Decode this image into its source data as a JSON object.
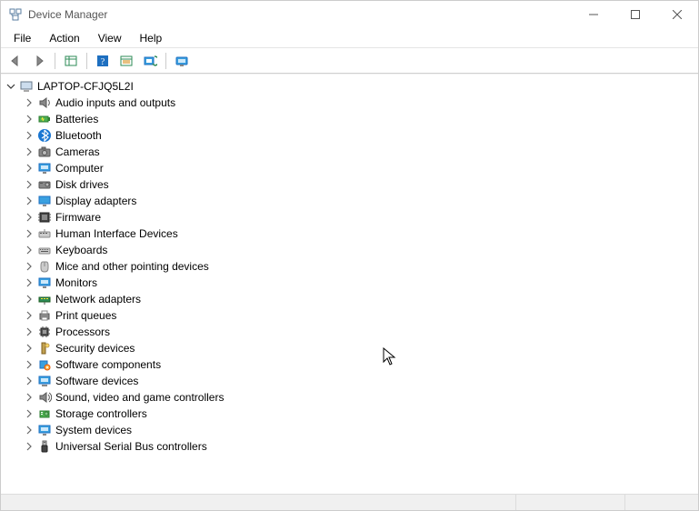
{
  "window": {
    "title": "Device Manager"
  },
  "menu": {
    "items": [
      "File",
      "Action",
      "View",
      "Help"
    ]
  },
  "tree": {
    "root": "LAPTOP-CFJQ5L2I",
    "categories": [
      {
        "id": "audio",
        "label": "Audio inputs and outputs"
      },
      {
        "id": "batteries",
        "label": "Batteries"
      },
      {
        "id": "bluetooth",
        "label": "Bluetooth"
      },
      {
        "id": "cameras",
        "label": "Cameras"
      },
      {
        "id": "computer",
        "label": "Computer"
      },
      {
        "id": "diskdrives",
        "label": "Disk drives"
      },
      {
        "id": "display",
        "label": "Display adapters"
      },
      {
        "id": "firmware",
        "label": "Firmware"
      },
      {
        "id": "hid",
        "label": "Human Interface Devices"
      },
      {
        "id": "keyboards",
        "label": "Keyboards"
      },
      {
        "id": "mice",
        "label": "Mice and other pointing devices"
      },
      {
        "id": "monitors",
        "label": "Monitors"
      },
      {
        "id": "network",
        "label": "Network adapters"
      },
      {
        "id": "printqueues",
        "label": "Print queues"
      },
      {
        "id": "processors",
        "label": "Processors"
      },
      {
        "id": "security",
        "label": "Security devices"
      },
      {
        "id": "swcomponents",
        "label": "Software components"
      },
      {
        "id": "swdevices",
        "label": "Software devices"
      },
      {
        "id": "sound",
        "label": "Sound, video and game controllers"
      },
      {
        "id": "storage",
        "label": "Storage controllers"
      },
      {
        "id": "system",
        "label": "System devices"
      },
      {
        "id": "usb",
        "label": "Universal Serial Bus controllers"
      }
    ]
  }
}
